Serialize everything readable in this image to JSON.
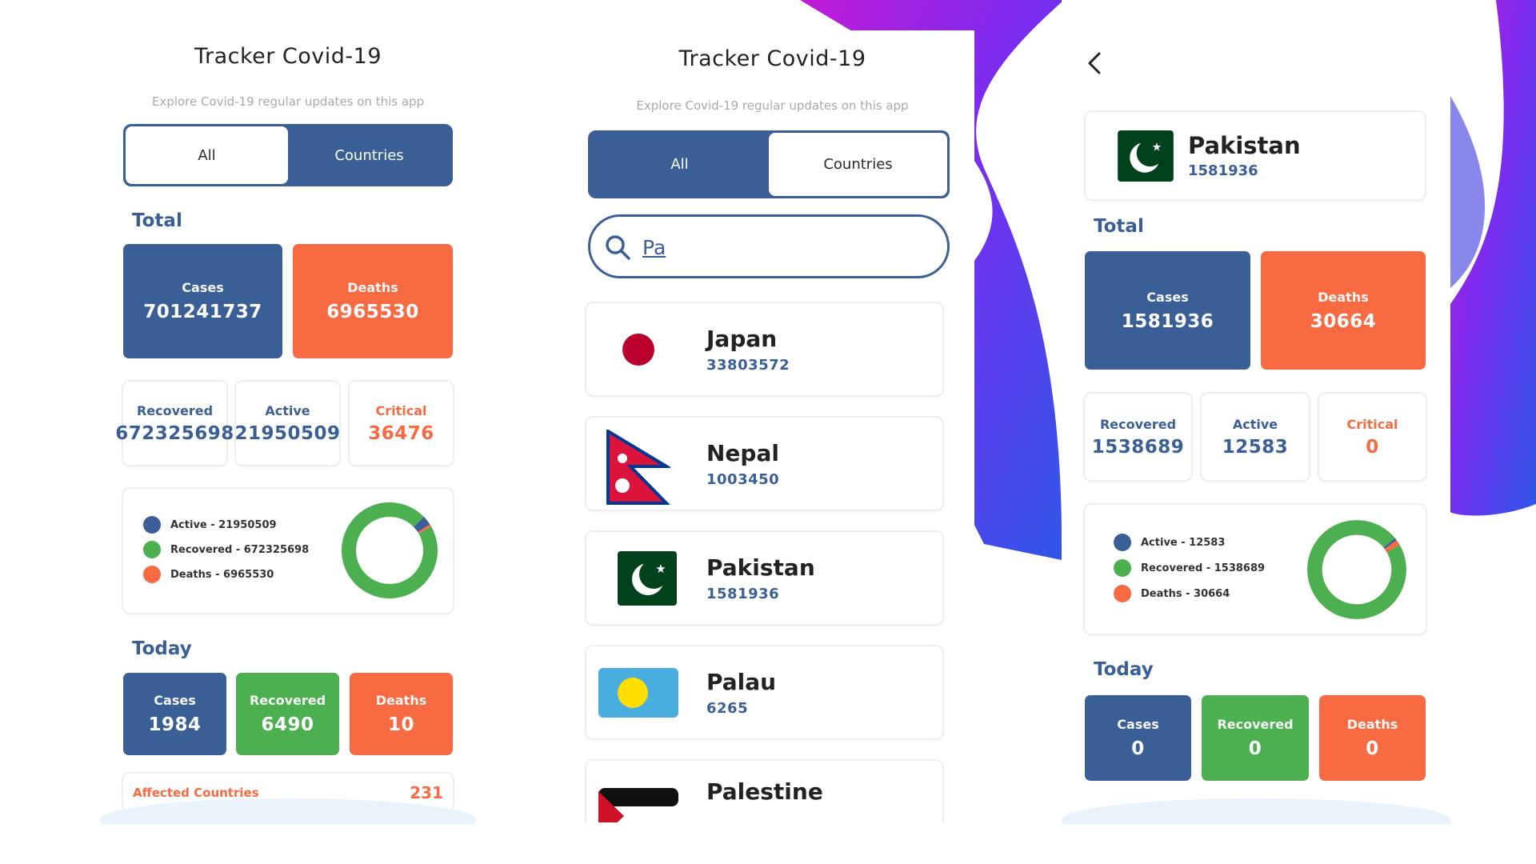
{
  "colors": {
    "primary": "#3a5f97",
    "deaths": "#f76a42",
    "recovered": "#4caf50",
    "card_border": "#eeeeee"
  },
  "screen1": {
    "title": "Tracker Covid-19",
    "subtitle": "Explore Covid-19 regular updates on this app",
    "tabs": [
      "All",
      "Countries"
    ],
    "selected_tab": "All",
    "total_heading": "Total",
    "total": {
      "cases_label": "Cases",
      "cases": "701241737",
      "deaths_label": "Deaths",
      "deaths": "6965530",
      "recovered_label": "Recovered",
      "recovered": "672325698",
      "active_label": "Active",
      "active": "21950509",
      "critical_label": "Critical",
      "critical": "36476"
    },
    "legend": [
      "Active - 21950509",
      "Recovered - 672325698",
      "Deaths - 6965530"
    ],
    "donut_values": {
      "active": 21950509,
      "recovered": 672325698,
      "deaths": 6965530
    },
    "today_heading": "Today",
    "today": {
      "cases_label": "Cases",
      "cases": "1984",
      "recovered_label": "Recovered",
      "recovered": "6490",
      "deaths_label": "Deaths",
      "deaths": "10"
    },
    "affected_label": "Affected Countries",
    "affected_value": "231"
  },
  "screen2": {
    "title": "Tracker Covid-19",
    "subtitle": "Explore Covid-19 regular updates on this app",
    "tabs": [
      "All",
      "Countries"
    ],
    "selected_tab": "Countries",
    "search_value": "Pa",
    "search_icon": "search-icon",
    "countries": [
      {
        "name": "Japan",
        "cases": "33803572",
        "flag": "japan-flag-icon"
      },
      {
        "name": "Nepal",
        "cases": "1003450",
        "flag": "nepal-flag-icon"
      },
      {
        "name": "Pakistan",
        "cases": "1581936",
        "flag": "pakistan-flag-icon"
      },
      {
        "name": "Palau",
        "cases": "6265",
        "flag": "palau-flag-icon"
      },
      {
        "name": "Palestine",
        "cases": "",
        "flag": "palestine-flag-icon"
      }
    ]
  },
  "screen3": {
    "back_icon": "chevron-left-icon",
    "country": {
      "name": "Pakistan",
      "cases": "1581936",
      "flag": "pakistan-flag-icon"
    },
    "total_heading": "Total",
    "total": {
      "cases_label": "Cases",
      "cases": "1581936",
      "deaths_label": "Deaths",
      "deaths": "30664",
      "recovered_label": "Recovered",
      "recovered": "1538689",
      "active_label": "Active",
      "active": "12583",
      "critical_label": "Critical",
      "critical": "0"
    },
    "legend": [
      "Active - 12583",
      "Recovered - 1538689",
      "Deaths - 30664"
    ],
    "donut_values": {
      "active": 12583,
      "recovered": 1538689,
      "deaths": 30664
    },
    "today_heading": "Today",
    "today": {
      "cases_label": "Cases",
      "cases": "0",
      "recovered_label": "Recovered",
      "recovered": "0",
      "deaths_label": "Deaths",
      "deaths": "0"
    }
  }
}
